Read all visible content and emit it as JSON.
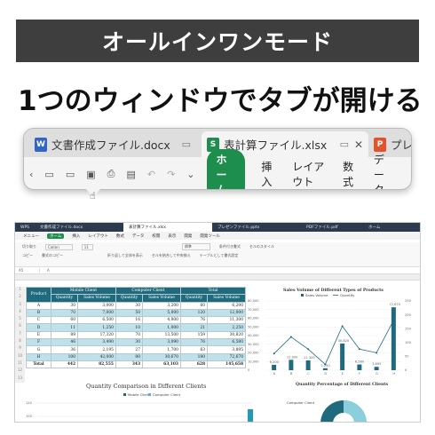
{
  "banner": "オールインワンモード",
  "headline": "1つのウィンドウでタブが開ける",
  "zoom": {
    "tabs": [
      {
        "icon": "W",
        "label": "文書作成ファイル.docx",
        "color": "#2f64c8"
      },
      {
        "icon": "S",
        "label": "表計算ファイル.xlsx",
        "color": "#1e8e4e"
      },
      {
        "icon": "P",
        "label": "プレ",
        "color": "#e4512a"
      }
    ],
    "home": "ホーム",
    "menus": [
      "挿入",
      "レイアウト",
      "数式",
      "データ"
    ]
  },
  "app": {
    "tabs": [
      "WPS",
      "文書作成ファイル.docx",
      "表計算ファイル.xlsx",
      "プレゼンファイル.pptx",
      "PDFファイル.pdf",
      "ホーム"
    ],
    "menu": [
      "メニュー",
      "ホーム",
      "挿入",
      "レイアウト",
      "数式",
      "データ",
      "校閲",
      "表示",
      "開発",
      "開発ツール"
    ],
    "ribbon1": [
      "切り取り",
      "Calibri",
      "11",
      "標準",
      "条件付き書式",
      "セルのスタイル"
    ],
    "ribbon2": [
      "コピー",
      "書式のコピー",
      "折り返して全体を表示",
      "セルを結合して中央揃え",
      "テーブルとして書式設定"
    ],
    "cell_ref": "A5",
    "fx": "A"
  },
  "table": {
    "headers_top": [
      "Product",
      "Mobile Client",
      "Computer Client",
      "Total"
    ],
    "headers_sub": [
      "Quantity",
      "Sales Volume",
      "Quantity",
      "Sales Volume",
      "Quantity",
      "Sales Volume"
    ],
    "rows": [
      [
        "A",
        "30",
        "3,000",
        "30",
        "3,200",
        "60",
        "6,200"
      ],
      [
        "B",
        "70",
        "7,000",
        "50",
        "5,000",
        "120",
        "12,000"
      ],
      [
        "C",
        "60",
        "6,500",
        "16",
        "4,800",
        "76",
        "11,300"
      ],
      [
        "D",
        "11",
        "1,250",
        "10",
        "1,000",
        "21",
        "2,250"
      ],
      [
        "E",
        "89",
        "17,320",
        "70",
        "13,500",
        "159",
        "30,820"
      ],
      [
        "F",
        "46",
        "3,490",
        "30",
        "3,090",
        "76",
        "6,580"
      ],
      [
        "G",
        "36",
        "2,195",
        "27",
        "1,700",
        "63",
        "3,895"
      ],
      [
        "H",
        "100",
        "42,000",
        "80",
        "30,670",
        "180",
        "72,670"
      ],
      [
        "Total",
        "442",
        "82,555",
        "343",
        "63,103",
        "628",
        "145,658"
      ]
    ],
    "row_numbers": [
      "1",
      "2",
      "3",
      "4",
      "5",
      "6",
      "7",
      "8",
      "9",
      "10",
      "11",
      "12",
      "13"
    ]
  },
  "chart_data": [
    {
      "type": "bar",
      "title": "Sales Volume of Different Types of Products",
      "categories": [
        "A",
        "B",
        "C",
        "D",
        "E",
        "F",
        "G",
        "H"
      ],
      "series": [
        {
          "name": "Sales Volume",
          "values": [
            6200,
            12000,
            11300,
            2250,
            30820,
            6580,
            3895,
            72670
          ]
        },
        {
          "name": "Quantity",
          "values": [
            60,
            120,
            76,
            21,
            159,
            76,
            63,
            180
          ]
        }
      ],
      "data_labels": [
        "6,200",
        "12,000",
        "11,300",
        "2,250",
        "30,820",
        "6,580",
        "3,895",
        "72,670"
      ],
      "ylim": [
        0,
        80000
      ],
      "y2lim": [
        0,
        250
      ],
      "y_ticks": [
        "0",
        "10,000",
        "20,000",
        "30,000",
        "40,000",
        "50,000",
        "60,000",
        "70,000",
        "80,000"
      ],
      "y2_ticks": [
        "0",
        "50",
        "100",
        "150",
        "200",
        "250"
      ]
    },
    {
      "type": "bar",
      "title": "Quantity Comparison in Different Clients",
      "series": [
        {
          "name": "Mobile Client"
        },
        {
          "name": "Computer Client"
        }
      ],
      "y_ticks": [
        "120",
        "100"
      ]
    },
    {
      "type": "pie",
      "title": "Quantity Percentage of Different Clients",
      "label": "Computer Client"
    }
  ],
  "colors": {
    "accent": "#1e8e4e",
    "teal": "#1f6b7d",
    "dark": "#2c3a4e"
  }
}
